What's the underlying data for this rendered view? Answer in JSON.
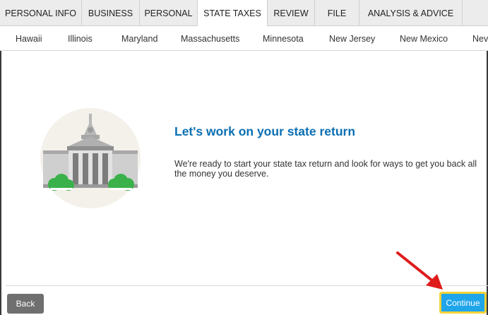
{
  "main_tabs": [
    {
      "label": "PERSONAL INFO",
      "active": false
    },
    {
      "label": "BUSINESS",
      "active": false
    },
    {
      "label": "PERSONAL",
      "active": false
    },
    {
      "label": "STATE TAXES",
      "active": true
    },
    {
      "label": "REVIEW",
      "active": false
    },
    {
      "label": "FILE",
      "active": false
    },
    {
      "label": "ANALYSIS & ADVICE",
      "active": false
    }
  ],
  "state_tabs": [
    {
      "label": "Hawaii"
    },
    {
      "label": "Illinois"
    },
    {
      "label": "Maryland"
    },
    {
      "label": "Massachusetts"
    },
    {
      "label": "Minnesota"
    },
    {
      "label": "New Jersey"
    },
    {
      "label": "New Mexico"
    },
    {
      "label": "Nev"
    }
  ],
  "main": {
    "title": "Let's work on your state return",
    "description": "We're ready to start your state tax return and look for ways to get you back all the money you deserve."
  },
  "footer": {
    "back_label": "Back",
    "continue_label": "Continue"
  },
  "colors": {
    "title": "#0b6fb3",
    "continue": "#1fa5ea",
    "highlight": "#f5d33a",
    "arrow": "#e01b1b"
  },
  "icons": {
    "illustration": "state-capitol-building-icon",
    "pointer": "red-arrow-annotation"
  }
}
